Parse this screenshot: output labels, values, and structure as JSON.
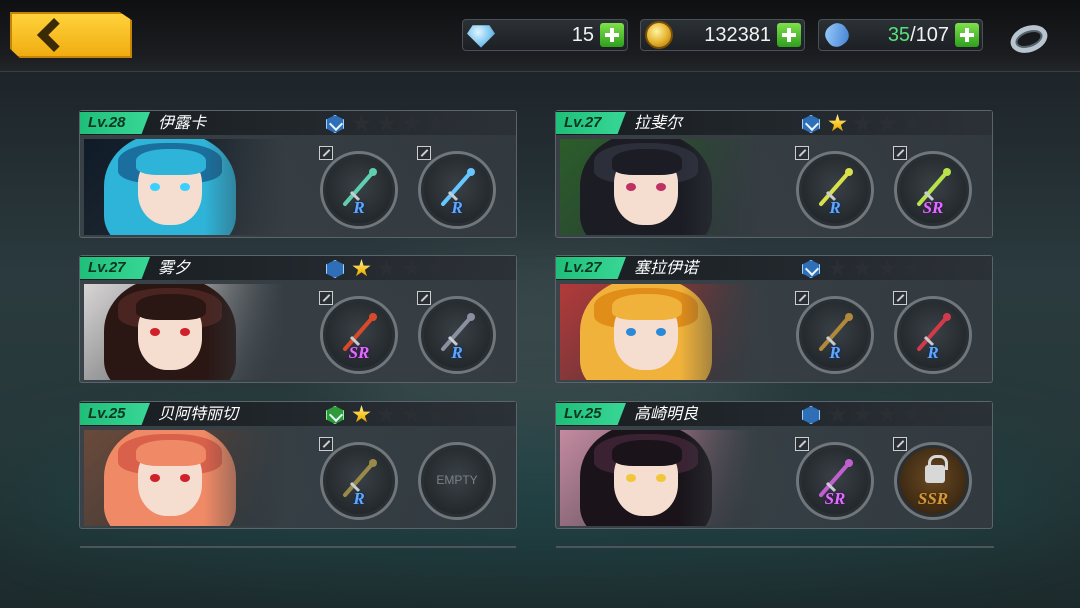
{
  "header": {
    "back_label": "back",
    "resources": [
      {
        "icon": "diamond-icon",
        "value": "15"
      },
      {
        "icon": "gold-coin-icon",
        "value": "132381"
      },
      {
        "icon": "stamina-pill-icon",
        "current": "35",
        "sep_max": "/107"
      }
    ]
  },
  "characters": [
    {
      "level": "Lv.28",
      "name": "伊露卡",
      "rank_icon": "blue-rank-icon",
      "stars": 0,
      "slots": [
        {
          "rarity": "R"
        },
        {
          "rarity": "R"
        }
      ]
    },
    {
      "level": "Lv.27",
      "name": "拉斐尔",
      "rank_icon": "blue-rank-icon",
      "stars": 1,
      "slots": [
        {
          "rarity": "R"
        },
        {
          "rarity": "SR"
        }
      ]
    },
    {
      "level": "Lv.27",
      "name": "雾夕",
      "rank_icon": "blue-hex-icon",
      "stars": 1,
      "slots": [
        {
          "rarity": "SR"
        },
        {
          "rarity": "R"
        }
      ]
    },
    {
      "level": "Lv.27",
      "name": "塞拉伊诺",
      "rank_icon": "blue-rank-icon",
      "stars": 0,
      "slots": [
        {
          "rarity": "R"
        },
        {
          "rarity": "R"
        }
      ]
    },
    {
      "level": "Lv.25",
      "name": "贝阿特丽切",
      "rank_icon": "green-rank-icon",
      "stars": 1,
      "slots": [
        {
          "rarity": "R"
        },
        {
          "empty": "EMPTY"
        }
      ]
    },
    {
      "level": "Lv.25",
      "name": "高崎明良",
      "rank_icon": "blue-hex-icon",
      "stars": 0,
      "slots": [
        {
          "rarity": "SR"
        },
        {
          "rarity": "SSR",
          "locked": true
        }
      ]
    }
  ],
  "colors": {
    "level_badge": "#1fbf7a",
    "rarity_r": "#5fa8ff",
    "rarity_sr": "#e06cff",
    "rarity_ssr": "#d49a3a",
    "star_on": "#f6c21a"
  }
}
